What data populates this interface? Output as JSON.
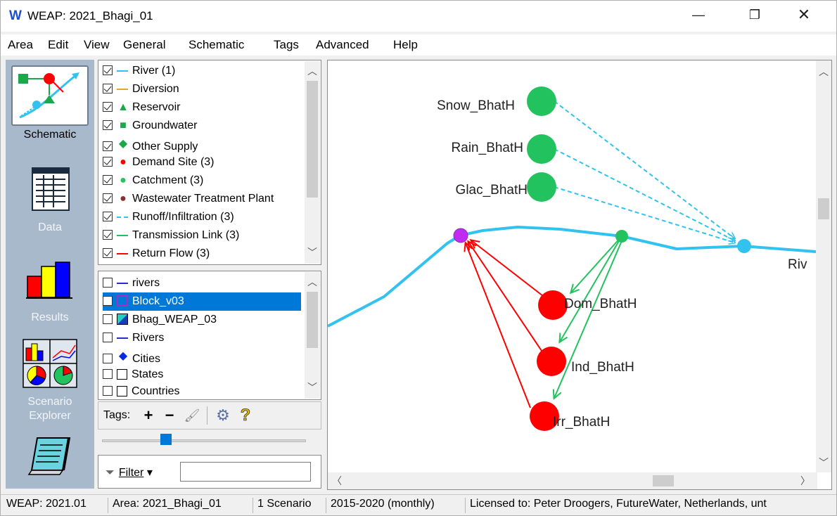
{
  "window": {
    "logo": "W",
    "title": "WEAP: 2021_Bhagi_01",
    "min_glyph": "—",
    "max_glyph": "❐",
    "close_glyph": "✕"
  },
  "menu": [
    "Area",
    "Edit",
    "View",
    "General",
    "Schematic",
    "Tags",
    "Advanced",
    "Help"
  ],
  "views": {
    "schematic_label": "Schematic",
    "data_label": "Data",
    "results_label": "Results",
    "scenario_label_1": "Scenario",
    "scenario_label_2": "Explorer",
    "active": "Schematic"
  },
  "legend": [
    {
      "label": "River (1)",
      "checked": true,
      "symbol": "line",
      "color": "#31c2ef"
    },
    {
      "label": "Diversion",
      "checked": true,
      "symbol": "line",
      "color": "#f0a030"
    },
    {
      "label": "Reservoir",
      "checked": true,
      "symbol": "triangle",
      "color": "#1aa84a"
    },
    {
      "label": "Groundwater",
      "checked": true,
      "symbol": "square",
      "color": "#1aa84a"
    },
    {
      "label": "Other Supply",
      "checked": true,
      "symbol": "diamond",
      "color": "#1aa84a"
    },
    {
      "label": "Demand Site (3)",
      "checked": true,
      "symbol": "circle",
      "color": "#ff0000"
    },
    {
      "label": "Catchment (3)",
      "checked": true,
      "symbol": "circle",
      "color": "#22c35e"
    },
    {
      "label": "Wastewater Treatment Plant",
      "checked": true,
      "symbol": "circle",
      "color": "#8b2f2f"
    },
    {
      "label": "Runoff/Infiltration (3)",
      "checked": true,
      "symbol": "dash",
      "color": "#31c2ef"
    },
    {
      "label": "Transmission Link (3)",
      "checked": true,
      "symbol": "line",
      "color": "#22c35e"
    },
    {
      "label": "Return Flow (3)",
      "checked": true,
      "symbol": "line",
      "color": "#ff0000"
    }
  ],
  "layers": [
    {
      "label": "rivers",
      "checked": false,
      "symbol": "line",
      "color": "#2a2ad0"
    },
    {
      "label": "Block_v03",
      "checked": false,
      "symbol": "box",
      "color": "#a030c0",
      "selected": true
    },
    {
      "label": "Bhag_WEAP_03",
      "checked": false,
      "symbol": "raster",
      "color": "#1a3fb0"
    },
    {
      "label": "Rivers",
      "checked": false,
      "symbol": "line",
      "color": "#2a2ad0"
    },
    {
      "label": "Cities",
      "checked": false,
      "symbol": "diamond",
      "color": "#0a2ae0"
    },
    {
      "label": "States",
      "checked": false,
      "symbol": "box",
      "color": "#000000"
    },
    {
      "label": "Countries",
      "checked": false,
      "symbol": "box",
      "color": "#000000"
    }
  ],
  "tags": {
    "label": "Tags:",
    "add": "+",
    "remove": "−",
    "brush": "🖌",
    "settings": "⚙",
    "help": "?"
  },
  "filter": {
    "label": "Filter",
    "dropdown_glyph": "▾",
    "value": ""
  },
  "schematic": {
    "catchments": [
      "Snow_BhatH",
      "Rain_BhatH",
      "Glac_BhatH"
    ],
    "demand_sites": [
      "Dom_BhatH",
      "Ind_BhatH",
      "Irr_BhatH"
    ],
    "river_label": "Riv"
  },
  "status": [
    "WEAP: 2021.01",
    "Area: 2021_Bhagi_01",
    "1 Scenario",
    "2015-2020 (monthly)",
    "Licensed to: Peter Droogers, FutureWater, Netherlands, unt"
  ]
}
